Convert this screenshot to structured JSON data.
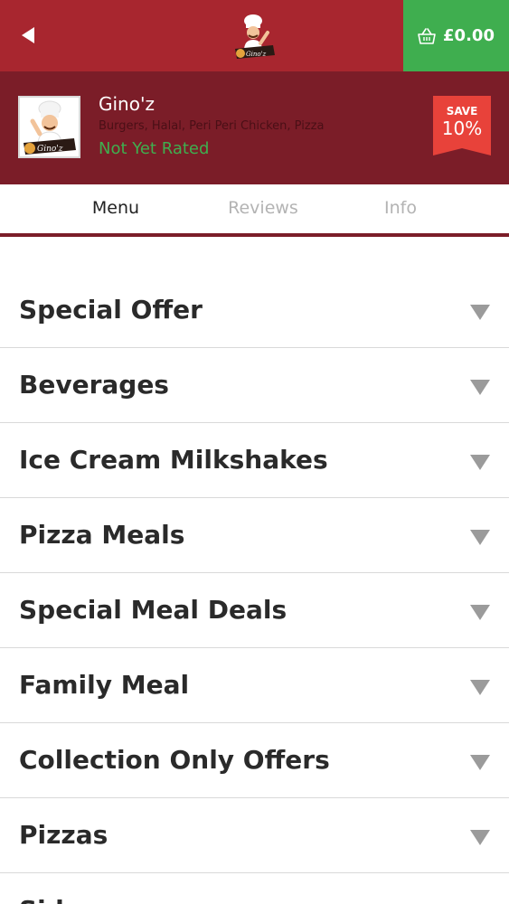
{
  "header": {
    "back_icon": "back-arrow-icon",
    "logo_icon": "ginoz-chef-logo",
    "cart_icon": "basket-icon",
    "cart_total": "£0.00"
  },
  "restaurant": {
    "name": "Gino'z",
    "cuisines": "Burgers, Halal, Peri Peri Chicken, Pizza",
    "rating": "Not Yet Rated",
    "discount_label": "SAVE",
    "discount_value": "10%",
    "logo_text": "Gino'z"
  },
  "tabs": [
    {
      "label": "Menu",
      "active": true
    },
    {
      "label": "Reviews",
      "active": false
    },
    {
      "label": "Info",
      "active": false
    }
  ],
  "categories": [
    {
      "label": "Special Offer"
    },
    {
      "label": "Beverages"
    },
    {
      "label": "Ice Cream Milkshakes"
    },
    {
      "label": "Pizza Meals"
    },
    {
      "label": "Special Meal Deals"
    },
    {
      "label": "Family Meal"
    },
    {
      "label": "Collection Only Offers"
    },
    {
      "label": "Pizzas"
    },
    {
      "label": "Sides"
    }
  ],
  "colors": {
    "topbar": "#a8262f",
    "header": "#7b1d28",
    "cart": "#3fae4f",
    "rating": "#3fae4f",
    "badge": "#e8423a"
  }
}
